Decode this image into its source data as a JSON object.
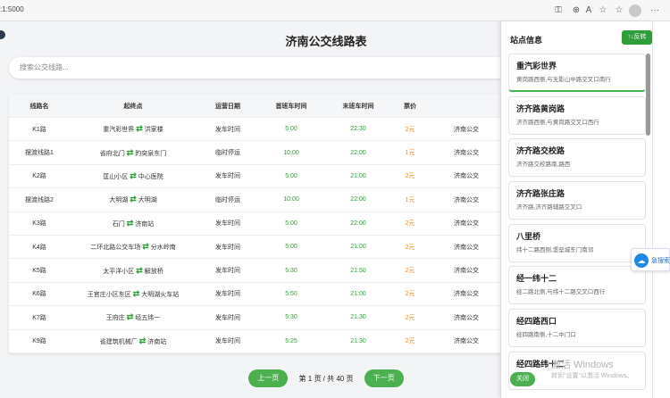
{
  "browser": {
    "url": ":1:5000"
  },
  "page": {
    "title": "济南公交线路表",
    "search_placeholder": "搜索公交线路..."
  },
  "table": {
    "headers": [
      "线路名",
      "起终点",
      "运营日期",
      "首班车时间",
      "末班车时间",
      "票价",
      ""
    ],
    "rows": [
      {
        "name": "K1路",
        "from": "重汽彩世界",
        "to": "洪家楼",
        "status": "发车时间",
        "first": "5:00",
        "last": "22:30",
        "fare": "2元",
        "extra": "济南公交"
      },
      {
        "name": "摆渡线路1",
        "from": "省府北门",
        "to": "趵突泉东门",
        "status": "临时停运",
        "first": "10:00",
        "last": "22:00",
        "fare": "1元",
        "extra": "济南公交"
      },
      {
        "name": "K2路",
        "from": "匡山小区",
        "to": "中心医院",
        "status": "发车时间",
        "first": "5:00",
        "last": "21:00",
        "fare": "2元",
        "extra": "济南公交"
      },
      {
        "name": "摆渡线路2",
        "from": "大明湖",
        "to": "大明湖",
        "status": "临时停运",
        "first": "10:00",
        "last": "22:00",
        "fare": "1元",
        "extra": "济南公交"
      },
      {
        "name": "K3路",
        "from": "石门",
        "to": "济南站",
        "status": "发车时间",
        "first": "5:00",
        "last": "22:00",
        "fare": "2元",
        "extra": "济南公交"
      },
      {
        "name": "K4路",
        "from": "二环北路公交车场",
        "to": "分水岭南",
        "status": "发车时间",
        "first": "5:00",
        "last": "21:00",
        "fare": "2元",
        "extra": "济南公交"
      },
      {
        "name": "K5路",
        "from": "太平洋小区",
        "to": "解放桥",
        "status": "发车时间",
        "first": "5:30",
        "last": "21:50",
        "fare": "2元",
        "extra": "济南公交"
      },
      {
        "name": "K6路",
        "from": "王官庄小区东区",
        "to": "大明湖火车站",
        "status": "发车时间",
        "first": "5:50",
        "last": "21:00",
        "fare": "2元",
        "extra": "济南公交"
      },
      {
        "name": "K7路",
        "from": "王府庄",
        "to": "经五纬一",
        "status": "发车时间",
        "first": "5:30",
        "last": "21:30",
        "fare": "2元",
        "extra": "济南公交"
      },
      {
        "name": "K9路",
        "from": "省建筑机械厂",
        "to": "济南站",
        "status": "发车时间",
        "first": "5:25",
        "last": "21:30",
        "fare": "2元",
        "extra": "济南公交"
      }
    ]
  },
  "pager": {
    "prev": "上一页",
    "info": "第 1 页 / 共 40 页",
    "next": "下一页"
  },
  "panel": {
    "title": "站点信息",
    "reverse_label": "↑↓反转",
    "close_label": "关闭",
    "stops": [
      {
        "name": "重汽彩世界",
        "addr": "黄岗路西侧,与无影山中路交叉口南行"
      },
      {
        "name": "济齐路黄岗路",
        "addr": "济齐路西侧,与黄岗路交叉口西行"
      },
      {
        "name": "济齐路交校路",
        "addr": "济齐路交校路南,路西"
      },
      {
        "name": "济齐路张庄路",
        "addr": "济齐路,济齐路辅路交叉口"
      },
      {
        "name": "八里桥",
        "addr": "纬十二路西侧,堡垒城东门南邻"
      },
      {
        "name": "经一纬十二",
        "addr": "经二路北侧,与纬十二路交叉口西行"
      },
      {
        "name": "经四路西口",
        "addr": "经四路南侧,十二中门口"
      },
      {
        "name": "经四路纬十二",
        "addr": ""
      }
    ]
  },
  "watermark": {
    "line1": "激活 Windows",
    "line2": "转到\"设置\"以激活 Windows。"
  },
  "float_widget": {
    "label": "急搜索"
  },
  "colors": {
    "accent": "#4caf50",
    "fare": "#f28c1b",
    "time": "#2e9e3a"
  }
}
